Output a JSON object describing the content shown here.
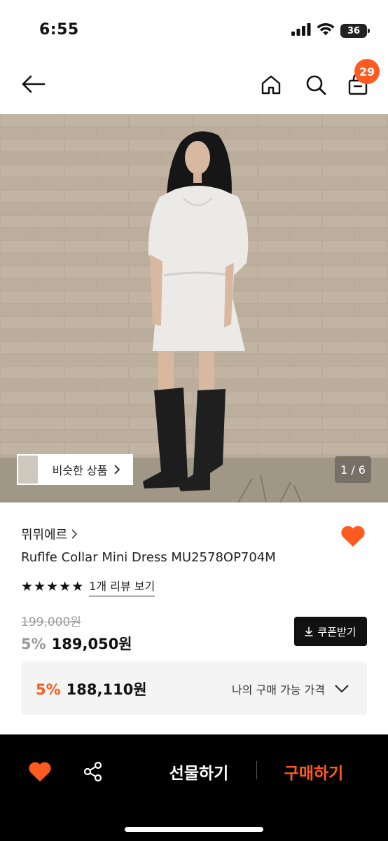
{
  "status_bar": {
    "time": "6:55",
    "battery": "36"
  },
  "header": {
    "cart_count": "29"
  },
  "gallery": {
    "similar_label": "비슷한 상품",
    "counter": "1 / 6"
  },
  "product": {
    "brand": "뮈뮈에르",
    "name": "Ruflfe Collar Mini Dress MU2578OP704M",
    "rating_stars": 5,
    "review_link": "1개 리뷰 보기",
    "original_price": "199,000원",
    "discount_pct": "5%",
    "price": "189,050원",
    "coupon_label": "쿠폰받기"
  },
  "my_price": {
    "discount_pct": "5%",
    "price": "188,110원",
    "label": "나의 구매 가능 가격"
  },
  "bottom_bar": {
    "gift_label": "선물하기",
    "buy_label": "구매하기"
  },
  "colors": {
    "accent": "#ff5a1f",
    "dark": "#111111",
    "muted": "#999999"
  }
}
